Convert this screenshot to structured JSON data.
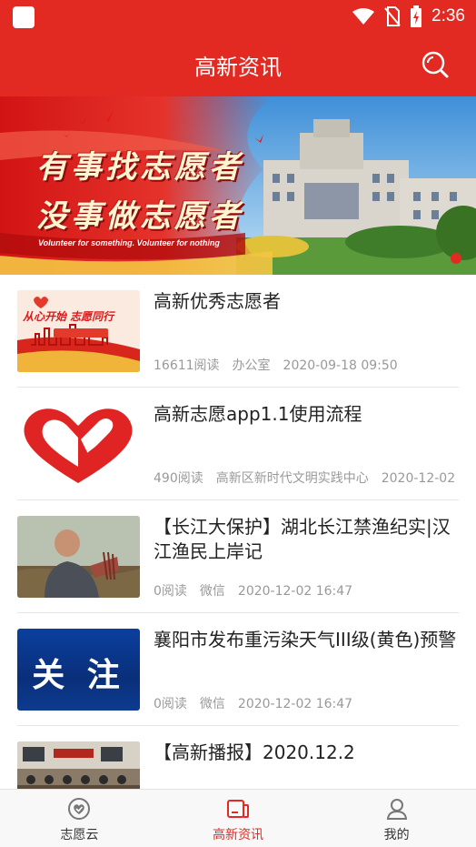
{
  "status_bar": {
    "time": "2:36"
  },
  "header": {
    "title": "高新资讯"
  },
  "banner": {
    "line1": "有事找志愿者",
    "line2": "没事做志愿者",
    "subtitle": "Volunteer for something. Volunteer for nothing"
  },
  "news": [
    {
      "title": "高新优秀志愿者",
      "reads": "16611阅读",
      "source": "办公室",
      "date": "2020-09-18 09:50",
      "thumb_text": "从心开始 志愿同行"
    },
    {
      "title": "高新志愿app1.1使用流程",
      "reads": "490阅读",
      "source": "高新区新时代文明实践中心",
      "date": "2020-12-02"
    },
    {
      "title": "【长江大保护】湖北长江禁渔纪实|汉江渔民上岸记",
      "reads": "0阅读",
      "source": "微信",
      "date": "2020-12-02 16:47"
    },
    {
      "title": "襄阳市发布重污染天气III级(黄色)预警",
      "reads": "0阅读",
      "source": "微信",
      "date": "2020-12-02 16:47",
      "thumb_text": "关 注"
    },
    {
      "title": "【高新播报】2020.12.2"
    }
  ],
  "bottom_nav": [
    {
      "label": "志愿云",
      "icon": "heart-check-icon",
      "active": false
    },
    {
      "label": "高新资讯",
      "icon": "news-icon",
      "active": true
    },
    {
      "label": "我的",
      "icon": "person-icon",
      "active": false
    }
  ],
  "colors": {
    "brand_red": "#e22a22",
    "meta_gray": "#999999",
    "nav_bg": "#f8f8f8"
  }
}
